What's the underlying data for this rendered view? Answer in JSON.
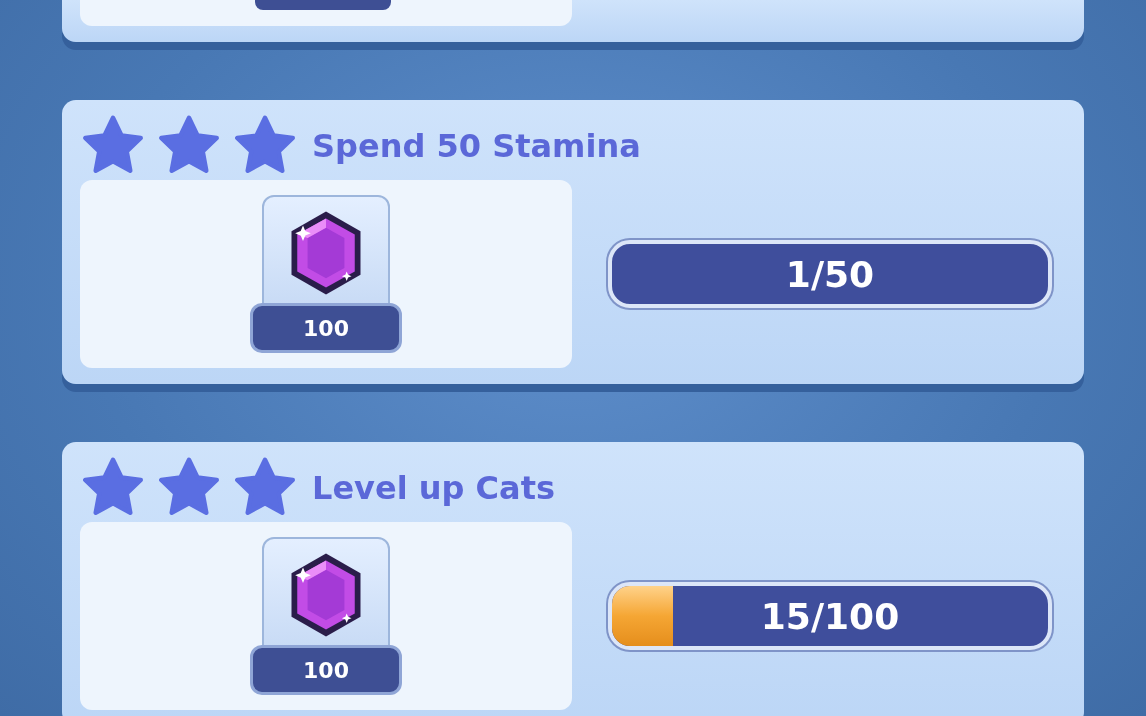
{
  "quests": [
    {
      "kind": "partial"
    },
    {
      "kind": "quest",
      "stars": 3,
      "title": "Spend 50 Stamina",
      "reward": "100",
      "progress": "1/50"
    },
    {
      "kind": "quest",
      "stars": 3,
      "title": "Level up Cats",
      "reward": "100",
      "progress": "15/100",
      "level": 0.14
    }
  ]
}
